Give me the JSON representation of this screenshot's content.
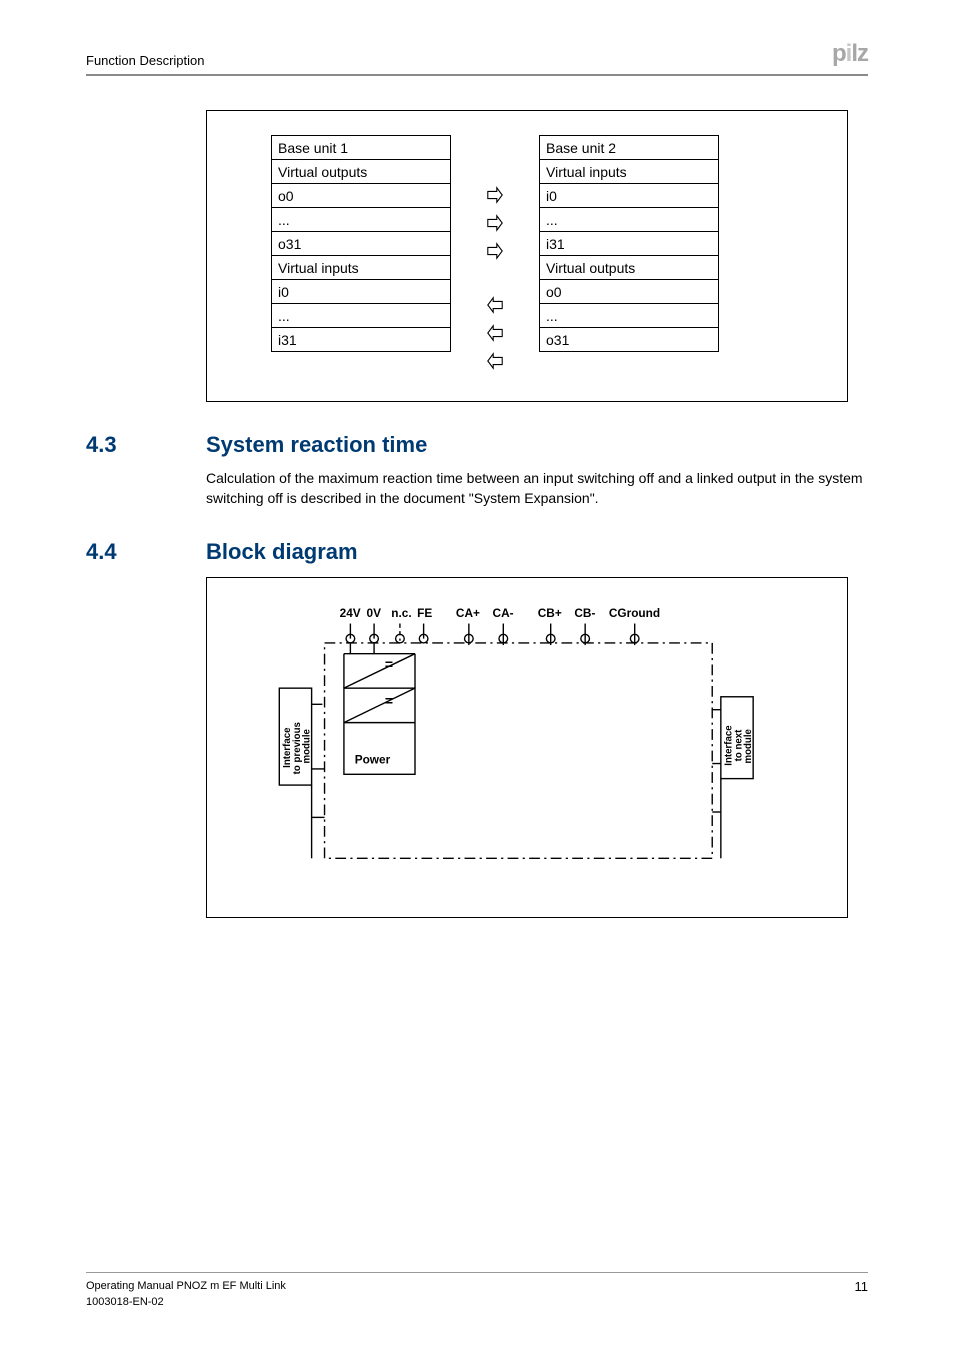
{
  "header": {
    "title": "Function Description",
    "logo": "pilz"
  },
  "diagram1": {
    "left": {
      "title": "Base unit 1",
      "outputs_label": "Virtual outputs",
      "o0": "o0",
      "dots": "...",
      "o31": "o31",
      "inputs_label": "Virtual inputs",
      "i0": "i0",
      "dots2": "...",
      "i31": "i31"
    },
    "right": {
      "title": "Base unit  2",
      "inputs_label": "Virtual inputs",
      "i0": "i0",
      "dots": "...",
      "i31": "i31",
      "outputs_label": "Virtual outputs",
      "o0": "o0",
      "dots2": "...",
      "o31": "o31"
    }
  },
  "section43": {
    "num": "4.3",
    "title": "System reaction time",
    "body": "Calculation of the maximum reaction time between an input switching off and a linked output in the system switching off is described in the document \"System Expansion\"."
  },
  "section44": {
    "num": "4.4",
    "title": "Block diagram"
  },
  "block": {
    "top_labels": [
      "24V",
      "0V",
      "n.c.",
      "FE",
      "CA+",
      "CA-",
      "CB+",
      "CB-",
      "CGround"
    ],
    "left_box": "Interface to previous module",
    "right_box": "Interface to next module",
    "power": "Power"
  },
  "footer": {
    "line1": "Operating Manual PNOZ m EF Multi Link",
    "line2": "1003018-EN-02",
    "page": "11"
  }
}
